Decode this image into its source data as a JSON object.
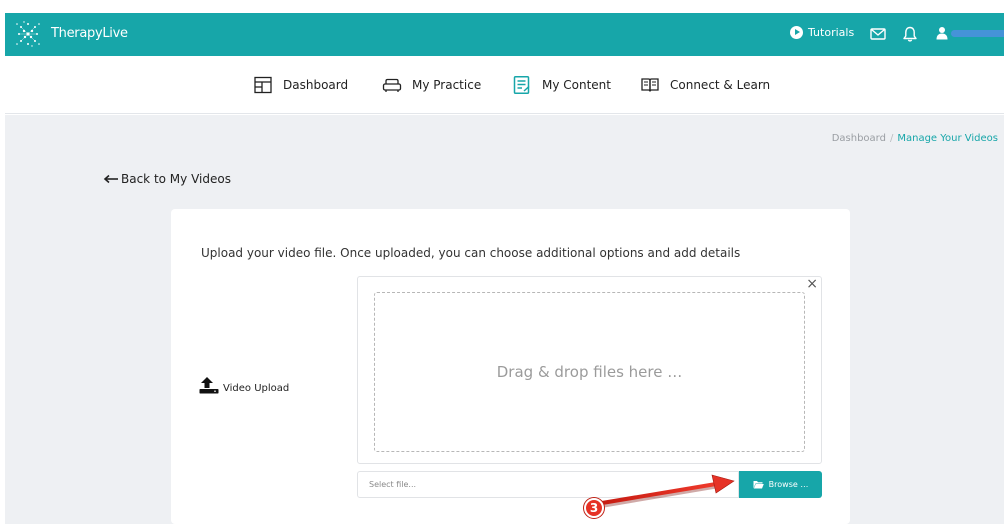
{
  "header": {
    "brand": "TherapyLive",
    "tutorials_label": "Tutorials",
    "user_name": ""
  },
  "nav": {
    "items": [
      {
        "label": "Dashboard",
        "icon": "dashboard-layout-icon"
      },
      {
        "label": "My Practice",
        "icon": "couch-icon"
      },
      {
        "label": "My Content",
        "icon": "content-list-icon"
      },
      {
        "label": "Connect & Learn",
        "icon": "book-open-icon"
      }
    ]
  },
  "breadcrumb": {
    "root": "Dashboard",
    "current": "Manage Your Videos"
  },
  "back_link": "Back to My Videos",
  "upload": {
    "instructions": "Upload your video file. Once uploaded, you can choose additional options and add details",
    "field_label": "Video Upload",
    "dropzone_text": "Drag & drop files here …",
    "file_placeholder": "Select file...",
    "browse_label": "Browse …",
    "close_symbol": "×"
  },
  "annotation": {
    "step_number": "3"
  },
  "colors": {
    "accent": "#17a6a9",
    "background": "#eef0f3",
    "annotation_red": "#e63226"
  }
}
